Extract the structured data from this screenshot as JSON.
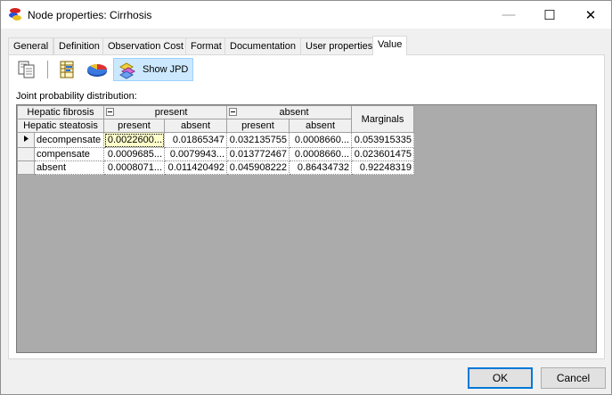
{
  "window": {
    "title": "Node properties: Cirrhosis",
    "controls": {
      "minimize": "—",
      "maximize": "☐",
      "close": "✕"
    }
  },
  "tabs": [
    {
      "label": "General"
    },
    {
      "label": "Definition"
    },
    {
      "label": "Observation Cost"
    },
    {
      "label": "Format"
    },
    {
      "label": "Documentation"
    },
    {
      "label": "User properties"
    },
    {
      "label": "Value",
      "active": true
    }
  ],
  "toolbar": {
    "copy_icon": "copy-icon",
    "table_icon": "table-icon",
    "pie_icon": "pie-chart-icon",
    "show_jpd_label": "Show JPD"
  },
  "jpd": {
    "label": "Joint probability distribution:",
    "parent1_name": "Hepatic fibrosis",
    "parent2_name": "Hepatic steatosis",
    "parent1_states": [
      "present",
      "absent"
    ],
    "parent2_states": [
      "present",
      "absent",
      "present",
      "absent"
    ],
    "marginals_label": "Marginals",
    "rows": [
      {
        "state": "decompensate",
        "values": [
          "0.0022600...",
          "0.01865347",
          "0.032135755",
          "0.0008660...",
          "0.053915335"
        ]
      },
      {
        "state": "compensate",
        "values": [
          "0.0009685...",
          "0.0079943...",
          "0.013772467",
          "0.0008660...",
          "0.023601475"
        ]
      },
      {
        "state": "absent",
        "values": [
          "0.0008071...",
          "0.011420492",
          "0.045908222",
          "0.86434732",
          "0.92248319"
        ]
      }
    ]
  },
  "buttons": {
    "ok": "OK",
    "cancel": "Cancel"
  }
}
